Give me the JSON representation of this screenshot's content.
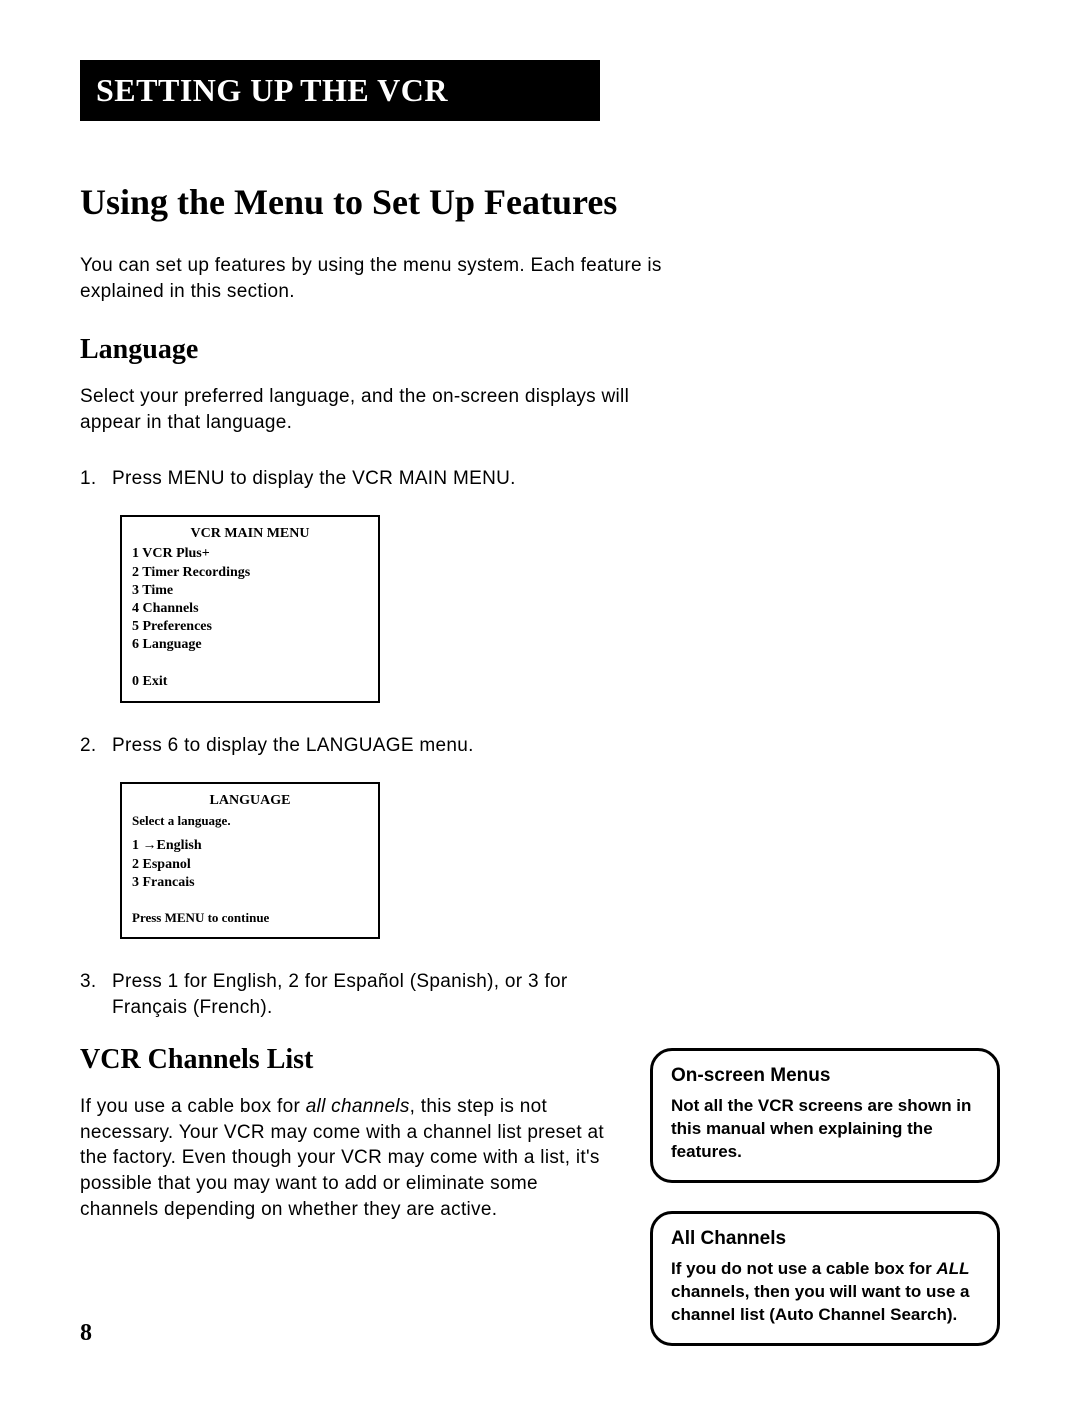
{
  "chapter_title": "SETTING UP THE VCR",
  "section_title": "Using the Menu to Set Up Features",
  "intro_text": "You can set up features by using the menu system. Each feature is explained in this section.",
  "lang": {
    "heading": "Language",
    "intro": "Select your preferred language, and the on-screen displays will appear in that language.",
    "step1_num": "1.",
    "step1_text": "Press MENU to display the VCR MAIN MENU.",
    "step2_num": "2.",
    "step2_text": "Press 6 to display the LANGUAGE menu.",
    "step3_num": "3.",
    "step3_text": "Press 1 for English, 2 for Español (Spanish), or 3 for Français (French)."
  },
  "menu1": {
    "title": "VCR MAIN MENU",
    "i1": "1 VCR Plus+",
    "i2": "2 Timer Recordings",
    "i3": "3 Time",
    "i4": "4 Channels",
    "i5": "5 Preferences",
    "i6": "6 Language",
    "exit": "0 Exit"
  },
  "menu2": {
    "title": "LANGUAGE",
    "select": "Select a language.",
    "o1": "1 →English",
    "o2": "2 Espanol",
    "o3": "3 Francais",
    "instr": "Press MENU to continue"
  },
  "channels": {
    "heading": "VCR Channels List",
    "p_pre": "If you use a cable box for ",
    "p_ital": "all channels",
    "p_post": ", this step is not necessary. Your VCR may come with a channel list preset at the factory. Even though your VCR may come with a list, it's possible that you may want to add or eliminate some channels depending on whether they are active."
  },
  "callout1": {
    "title": "On-screen Menus",
    "body": "Not all the VCR screens are shown in this manual when explaining the features."
  },
  "callout2": {
    "title": "All Channels",
    "b_pre": "If you do not use a cable box for ",
    "b_ital": "ALL",
    "b_post": " channels, then you will want to use a channel list (Auto Channel Search)."
  },
  "page_number": "8"
}
